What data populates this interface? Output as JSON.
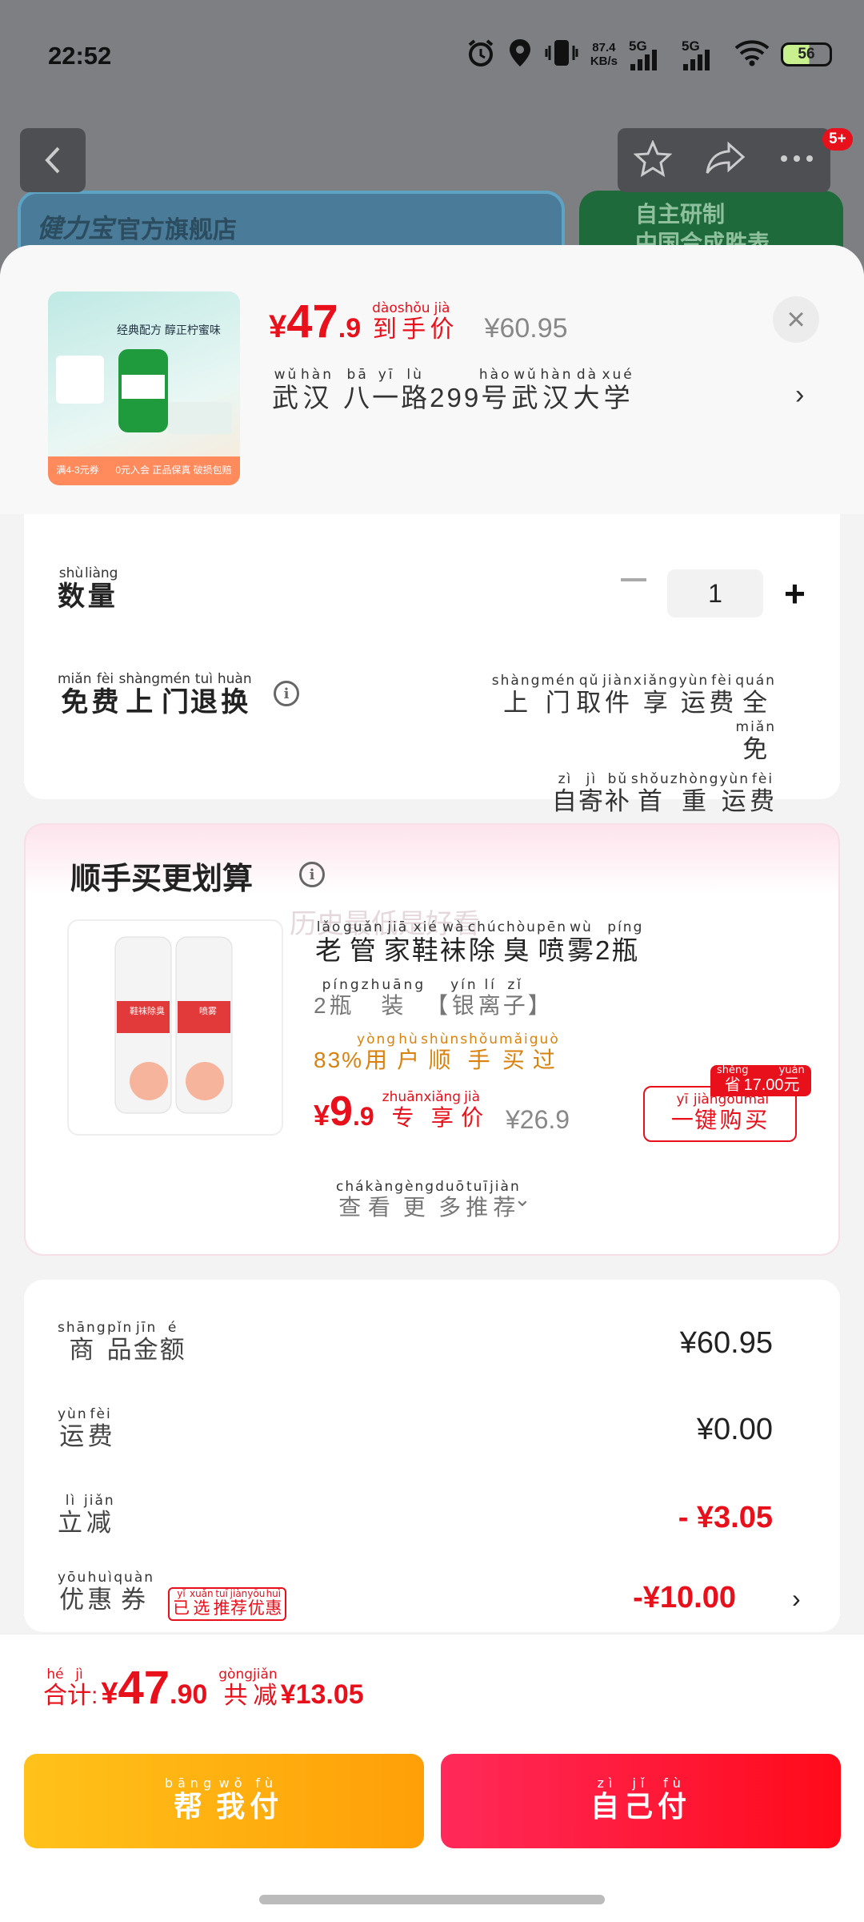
{
  "status_bar": {
    "time": "22:52",
    "net_speed_value": "87.4",
    "net_speed_unit": "KB/s",
    "sig1": "5G",
    "sig2": "5G",
    "battery": "56"
  },
  "background": {
    "badge": "5+",
    "store_name": "官方旗舰店",
    "store_logo_text": "健力宝",
    "banner2_line1": "自主研制",
    "banner2_line2": "中国合成胜表"
  },
  "product": {
    "price_symbol": "¥",
    "price_int": "47",
    "price_dec": ".9",
    "final_label": [
      "到",
      "手",
      "价"
    ],
    "final_label_py": [
      "dào",
      "shǒu",
      "jià"
    ],
    "orig_price": "¥60.95",
    "addr_chars": [
      "武",
      "汉",
      " ",
      "八",
      "一",
      "路"
    ],
    "addr_py": [
      "wǔ",
      "hàn",
      "",
      "bā",
      "yī",
      "lù"
    ],
    "addr_num": "299",
    "addr_chars2": [
      "号",
      "武",
      "汉",
      "大",
      "学"
    ],
    "addr_py2": [
      "hào",
      "wǔ",
      "hàn",
      "dà",
      "xué"
    ],
    "close": "×",
    "arrow": "›",
    "thumb_text1": "经典配方 醇正柠蜜味",
    "thumb_text2": "满4-3元券",
    "thumb_text3": "0元入会 正品保真 破损包赔"
  },
  "options": {
    "qty_label": [
      "数",
      "量"
    ],
    "qty_py": [
      "shù",
      "liàng"
    ],
    "qty_value": "1",
    "minus": "−",
    "plus": "+",
    "free_label": [
      "免",
      "费",
      "上",
      "门",
      "退",
      "换"
    ],
    "free_py": [
      "miǎn",
      "fèi",
      "shàng",
      "mén",
      "tuì",
      "huàn"
    ],
    "info": "i",
    "free_right1": [
      "上",
      "门",
      "取",
      "件",
      "享",
      "运",
      "费",
      "全",
      "免"
    ],
    "free_right1_py": [
      "shàng",
      "mén",
      "qǔ",
      "jiàn",
      "xiǎng",
      "yùn",
      "fèi",
      "quán",
      "miǎn"
    ],
    "free_right2": [
      "自",
      "寄",
      "补",
      "首",
      "重",
      "运",
      "费"
    ],
    "free_right2_py": [
      "zì",
      "jì",
      "bǔ",
      "shǒu",
      "zhòng",
      "yùn",
      "fèi"
    ]
  },
  "addon": {
    "section_title": "顺手买更划算",
    "watermark": "历史最低是好看",
    "title_chars": [
      "老",
      "管",
      "家",
      "鞋",
      "袜",
      "除",
      "臭",
      "喷",
      "雾"
    ],
    "title_py": [
      "lǎo",
      "guǎn",
      "jiā",
      "xié",
      "wà",
      "chú",
      "chòu",
      "pēn",
      "wù"
    ],
    "title_num": "2",
    "title_last": [
      "瓶"
    ],
    "title_last_py": [
      "píng"
    ],
    "sub_num": "2",
    "sub_chars": [
      "瓶",
      "装",
      "【",
      "银",
      "离",
      "子",
      "】"
    ],
    "sub_py": [
      "píng",
      "zhuāng",
      "",
      "yín",
      "lí",
      "zǐ",
      ""
    ],
    "buy_pct": "83%",
    "buy_chars": [
      "用",
      "户",
      "顺",
      "手",
      "买",
      "过"
    ],
    "buy_py": [
      "yòng",
      "hù",
      "shùn",
      "shǒu",
      "mǎi",
      "guò"
    ],
    "price_symbol": "¥",
    "price_int": "9",
    "price_dec": ".9",
    "exclusive": [
      "专",
      "享",
      "价"
    ],
    "exclusive_py": [
      "zhuān",
      "xiǎng",
      "jià"
    ],
    "orig_price": "¥26.9",
    "save_char": "省",
    "save_py": "shěng",
    "save_amount": "17.00",
    "save_unit": "元",
    "save_unit_py": "yuán",
    "onekey": [
      "一",
      "键",
      "购",
      "买"
    ],
    "onekey_py": [
      "yī",
      "jiàn",
      "gòu",
      "mǎi"
    ],
    "more": [
      "查",
      "看",
      "更",
      "多",
      "推",
      "荐"
    ],
    "more_py": [
      "chá",
      "kàn",
      "gèng",
      "duō",
      "tuī",
      "jiàn"
    ],
    "more_chevron": "⌄",
    "can_text1": "鞋袜除臭",
    "can_text2": "喷雾"
  },
  "summary": {
    "rows": [
      {
        "label": [
          "商",
          "品",
          "金",
          "额"
        ],
        "py": [
          "shāng",
          "pǐn",
          "jīn",
          "é"
        ],
        "value": "¥60.95"
      },
      {
        "label": [
          "运",
          "费"
        ],
        "py": [
          "yùn",
          "fèi"
        ],
        "value": "¥0.00"
      },
      {
        "label": [
          "立",
          "减"
        ],
        "py": [
          "lì",
          "jiǎn"
        ],
        "value": "- ¥3.05"
      },
      {
        "label": [
          "优",
          "惠",
          "券"
        ],
        "py": [
          "yōu",
          "huì",
          "quàn"
        ],
        "value": "-¥10.00"
      }
    ],
    "coupon_tag": [
      "已",
      "选",
      "推",
      "荐",
      "优",
      "惠"
    ],
    "coupon_tag_py": [
      "yǐ",
      "xuǎn",
      "tuī",
      "jiàn",
      "yōu",
      "huì"
    ],
    "arrow": "›"
  },
  "footer": {
    "total_label": [
      "合",
      "计"
    ],
    "total_py": [
      "hé",
      "jì"
    ],
    "colon": ":",
    "total_symbol": "¥",
    "total_int": "47",
    "total_dec": ".90",
    "reduce_label": [
      "共",
      "减"
    ],
    "reduce_py": [
      "gòng",
      "jiǎn"
    ],
    "reduce_value": "¥13.05",
    "help_btn": [
      "帮",
      "我",
      "付"
    ],
    "help_py": [
      "bāng",
      "wǒ",
      "fù"
    ],
    "self_btn": [
      "自",
      "己",
      "付"
    ],
    "self_py": [
      "zì",
      "jǐ",
      "fù"
    ]
  },
  "colors": {
    "accent_red": "#e8101a",
    "help_btn": "#ffb111",
    "self_btn": "#ff1a3c",
    "orange_text": "#d9820d"
  }
}
